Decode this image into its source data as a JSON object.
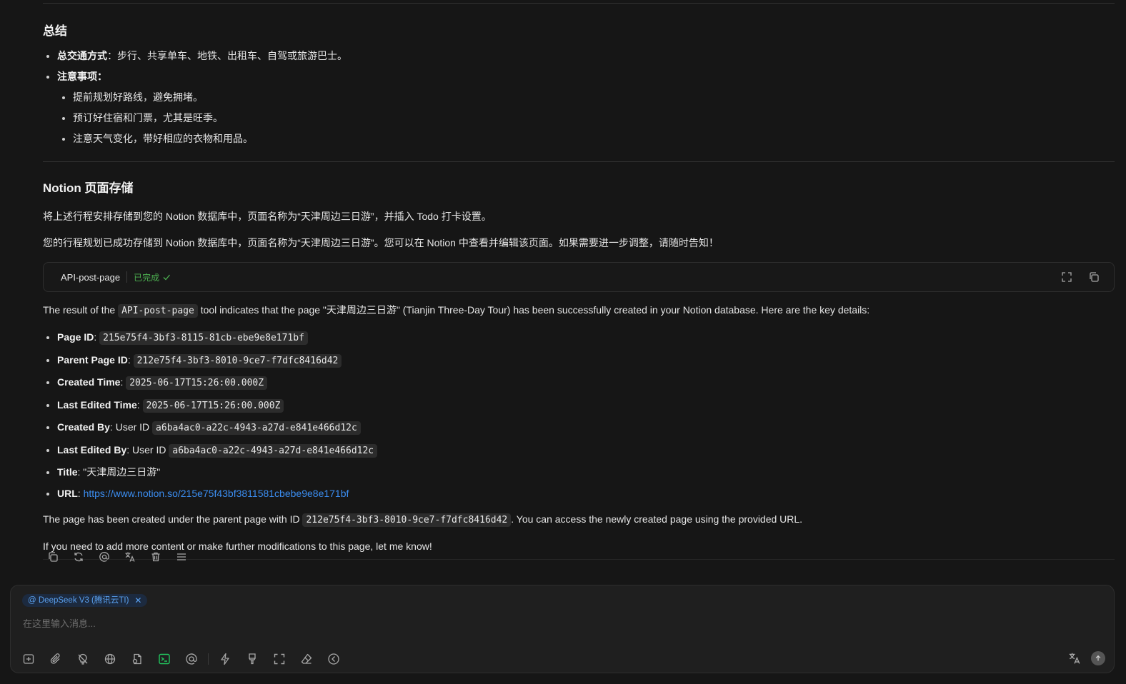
{
  "summary": {
    "heading": "总结",
    "transport_label": "总交通方式",
    "transport_text": "：步行、共享单车、地铁、出租车、自驾或旅游巴士。",
    "notes_label": "注意事项",
    "notes_colon": "：",
    "notes": [
      "提前规划好路线，避免拥堵。",
      "预订好住宿和门票，尤其是旺季。",
      "注意天气变化，带好相应的衣物和用品。"
    ]
  },
  "notion": {
    "heading": "Notion 页面存储",
    "para1": "将上述行程安排存储到您的 Notion 数据库中，页面名称为“天津周边三日游”，并插入 Todo 打卡设置。",
    "para2": "您的行程规划已成功存储到 Notion 数据库中，页面名称为“天津周边三日游”。您可以在 Notion 中查看并编辑该页面。如果需要进一步调整，请随时告知！"
  },
  "tool_card": {
    "name": "API-post-page",
    "status": "已完成",
    "status_color": "#4caf50"
  },
  "result": {
    "intro_pre": "The result of the ",
    "intro_code": "API-post-page",
    "intro_post": " tool indicates that the page \"天津周边三日游\" (Tianjin Three-Day Tour) has been successfully created in your Notion database. Here are the key details:",
    "details": [
      {
        "label": "Page ID",
        "sep": ": ",
        "pre": "",
        "code": "215e75f4-3bf3-8115-81cb-ebe9e8e171bf"
      },
      {
        "label": "Parent Page ID",
        "sep": ": ",
        "pre": "",
        "code": "212e75f4-3bf3-8010-9ce7-f7dfc8416d42"
      },
      {
        "label": "Created Time",
        "sep": ": ",
        "pre": "",
        "code": "2025-06-17T15:26:00.000Z"
      },
      {
        "label": "Last Edited Time",
        "sep": ": ",
        "pre": "",
        "code": "2025-06-17T15:26:00.000Z"
      },
      {
        "label": "Created By",
        "sep": ": ",
        "pre": "User ID ",
        "code": "a6ba4ac0-a22c-4943-a27d-e841e466d12c"
      },
      {
        "label": "Last Edited By",
        "sep": ": ",
        "pre": "User ID ",
        "code": "a6ba4ac0-a22c-4943-a27d-e841e466d12c"
      }
    ],
    "title_label": "Title",
    "title_value": ": \"天津周边三日游\"",
    "url_label": "URL",
    "url_sep": ": ",
    "url": "https://www.notion.so/215e75f43bf3811581cbebe9e8e171bf",
    "outro1_pre": "The page has been created under the parent page with ID ",
    "outro1_code": "212e75f4-3bf3-8010-9ce7-f7dfc8416d42",
    "outro1_post": ". You can access the newly created page using the provided URL.",
    "outro2": "If you need to add more content or make further modifications to this page, let me know!"
  },
  "composer": {
    "model_chip": "@ DeepSeek V3 (腾讯云TI)",
    "placeholder": "在这里输入消息..."
  },
  "colors": {
    "background": "#161616",
    "link": "#3b8df0",
    "accent_green": "#4caf50",
    "chip_text": "#5aa0ee"
  }
}
